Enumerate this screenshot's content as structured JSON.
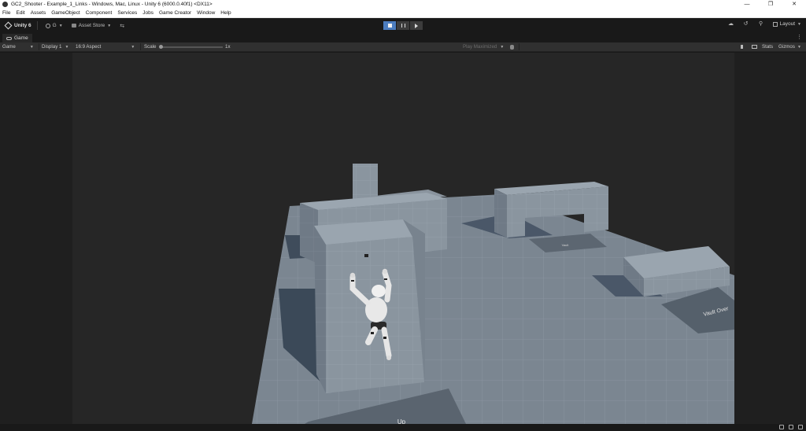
{
  "window": {
    "title": "GC2_Shooter - Example_1_Links - Windows, Mac, Linux - Unity 6 (6000.0.40f1) <DX11>",
    "controls": [
      "—",
      "❐",
      "✕"
    ]
  },
  "menu": {
    "items": [
      "File",
      "Edit",
      "Assets",
      "GameObject",
      "Component",
      "Services",
      "Jobs",
      "Game Creator",
      "Window",
      "Help"
    ]
  },
  "toolbar": {
    "unity_label": "Unity 6",
    "account_label": "G",
    "asset_store_label": "Asset Store",
    "layout_label": "Layout"
  },
  "tab": {
    "label": "Game"
  },
  "gamebar": {
    "mode": "Game",
    "display": "Display 1",
    "aspect": "16:9 Aspect",
    "scale_label": "Scale",
    "scale_value": "1x",
    "play_maximized": "Play Maximized",
    "stats": "Stats",
    "gizmos": "Gizmos"
  },
  "scene": {
    "floor_label_1": "Vault",
    "floor_label_2": "Vault Over",
    "floor_label_3": "Up"
  },
  "colors": {
    "accent_play": "#4c7dbf",
    "floor": "#7d8893",
    "block_light": "#8b96a1",
    "shadow": "#3b4958"
  }
}
